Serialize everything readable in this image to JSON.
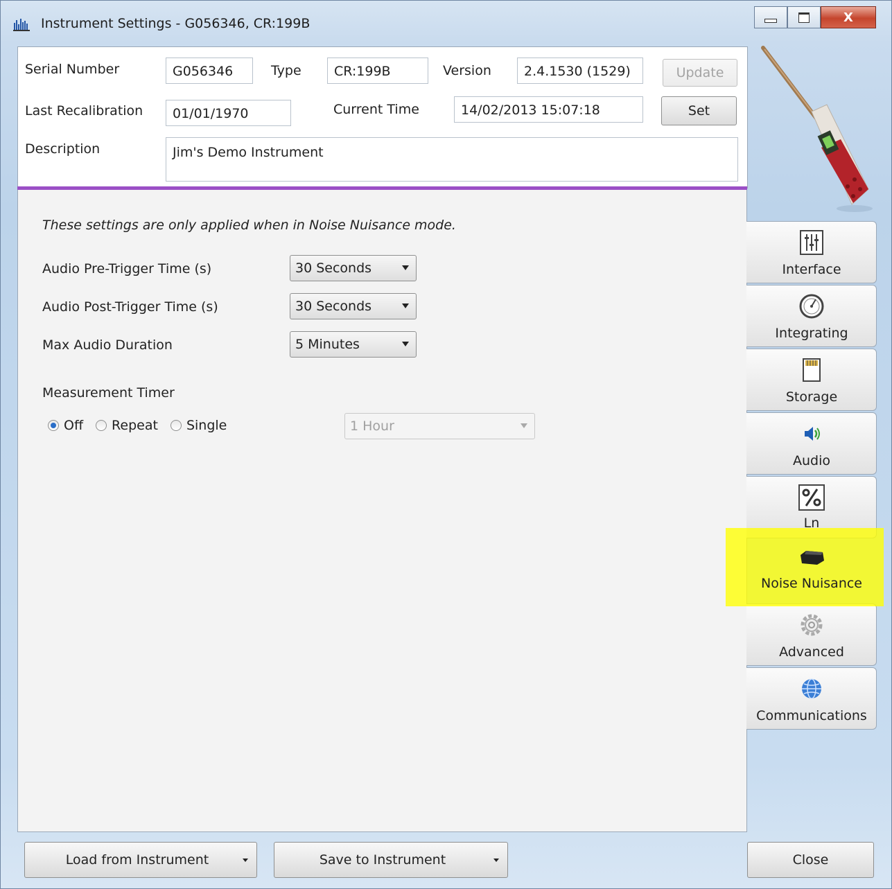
{
  "window": {
    "title": "Instrument Settings - G056346, CR:199B",
    "close_glyph": "X"
  },
  "header": {
    "serial_label": "Serial Number",
    "serial_value": "G056346",
    "type_label": "Type",
    "type_value": "CR:199B",
    "version_label": "Version",
    "version_value": "2.4.1530  (1529)",
    "update_button": "Update",
    "last_recal_label": "Last Recalibration",
    "last_recal_value": "01/01/1970",
    "current_time_label": "Current Time",
    "current_time_value": "14/02/2013 15:07:18",
    "set_button": "Set",
    "description_label": "Description",
    "description_value": "Jim's Demo Instrument"
  },
  "main": {
    "note": "These settings are only applied when in Noise Nuisance mode.",
    "pre_trigger_label": "Audio Pre-Trigger Time (s)",
    "pre_trigger_value": "30 Seconds",
    "post_trigger_label": "Audio Post-Trigger Time (s)",
    "post_trigger_value": "30 Seconds",
    "max_duration_label": "Max Audio Duration",
    "max_duration_value": "5 Minutes",
    "timer_label": "Measurement Timer",
    "timer_options": [
      "Off",
      "Repeat",
      "Single"
    ],
    "timer_selected": "Off",
    "timer_duration_value": "1 Hour"
  },
  "tabs": [
    {
      "label": "Interface",
      "icon": "sliders-icon"
    },
    {
      "label": "Integrating",
      "icon": "gauge-icon"
    },
    {
      "label": "Storage",
      "icon": "sd-card-icon"
    },
    {
      "label": "Audio",
      "icon": "speaker-icon"
    },
    {
      "label": "Ln",
      "icon": "percent-icon"
    },
    {
      "label": "Noise Nuisance",
      "icon": "recorder-icon"
    },
    {
      "label": "Advanced",
      "icon": "gear-icon"
    },
    {
      "label": "Communications",
      "icon": "globe-icon"
    }
  ],
  "selected_tab": "Noise Nuisance",
  "highlight_color": "#ffff00",
  "accent_color": "#9b4fc6",
  "footer": {
    "load_button": "Load from Instrument",
    "save_button": "Save to Instrument",
    "close_button": "Close"
  }
}
